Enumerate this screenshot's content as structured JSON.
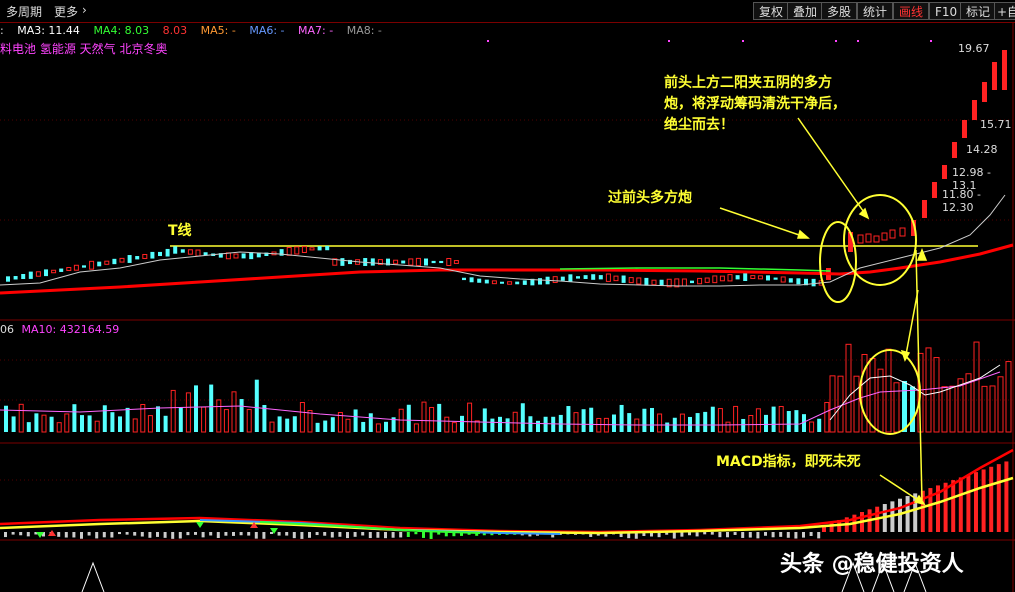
{
  "topbar": {
    "left_tabs": [
      "多周期",
      "更多"
    ],
    "right_buttons": [
      "复权",
      "叠加",
      "多股",
      "统计",
      "画线",
      "F10",
      "标记",
      "+自"
    ]
  },
  "ma_row": [
    {
      "label": "MA3: 11.44",
      "color": "#ffffff"
    },
    {
      "label": "MA4: 8.03",
      "color": "#33ff33"
    },
    {
      "label": "8.03",
      "color": "#ff3333"
    },
    {
      "label": "MA5: -",
      "color": "#ff9933"
    },
    {
      "label": "MA6: -",
      "color": "#6699ff"
    },
    {
      "label": "MA7: -",
      "color": "#ff66ff"
    },
    {
      "label": "MA8: -",
      "color": "#999999"
    }
  ],
  "concepts": "料电池 氢能源 天然气 北京冬奥",
  "volume_label": {
    "prefix": "06",
    "ma10": "MA10: 432164.59"
  },
  "price_labels": [
    "19.67",
    "15.71",
    "14.28",
    "12.98 - 13.1",
    "11.80 - 12.30"
  ],
  "annotations": {
    "t_line": "T线",
    "pass_cannon": "过前头多方炮",
    "cannon_line1": "前头上方二阳夹五阴的多方",
    "cannon_line2": "炮，将浮动筹码清洗干净后，",
    "cannon_line3": "绝尘而去！",
    "macd": "MACD指标，即死未死"
  },
  "watermark": "头条 @稳健投资人",
  "colors": {
    "up": "#ff2222",
    "down": "#55ffff",
    "annot": "#ffff33",
    "ma_long": "#ff0000"
  }
}
